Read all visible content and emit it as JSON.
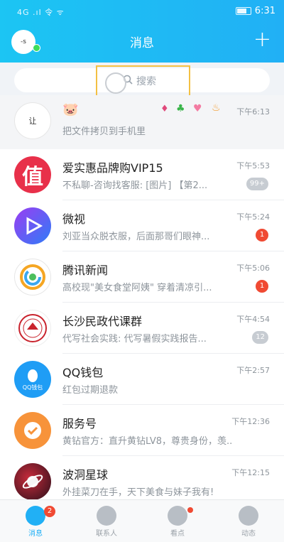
{
  "status_bar": {
    "left": "4G .ıl 令 ᯤ",
    "time": "6:31",
    "battery": "70"
  },
  "header": {
    "title": "消息",
    "avatar_text": "-s"
  },
  "search": {
    "placeholder": "搜索"
  },
  "conversations": [
    {
      "name": "",
      "avatar_text": "让",
      "time": "下午6:13",
      "message": "把文件拷贝到手机里",
      "badge": "",
      "extra_icons": [
        "pig-emoji",
        "sparkle",
        "clover",
        "heart",
        "flame"
      ]
    },
    {
      "name": "爱实惠品牌购VIP15",
      "avatar_text": "值",
      "time": "下午5:53",
      "message": "不私聊-咨询找客服: [图片] 【第2...",
      "badge": "99+",
      "badge_grey": true
    },
    {
      "name": "微视",
      "avatar_text": "",
      "time": "下午5:24",
      "message": "刘亚当众脱衣服，后面那哥们眼神...",
      "badge": "1"
    },
    {
      "name": "腾讯新闻",
      "avatar_text": "",
      "time": "下午5:06",
      "message": "高校现\"美女食堂阿姨\" 穿着清凉引...",
      "badge": "1"
    },
    {
      "name": "长沙民政代课群",
      "avatar_text": "",
      "time": "下午4:54",
      "message": "代写社会实践: 代写暑假实践报告...",
      "badge": "12",
      "badge_grey": true
    },
    {
      "name": "QQ钱包",
      "avatar_text": "QQ钱包",
      "time": "下午2:57",
      "message": "红包过期退款",
      "badge": ""
    },
    {
      "name": "服务号",
      "avatar_text": "",
      "time": "下午12:36",
      "message": "黄钻官方：直升黄钻LV8，尊贵身份，羡...",
      "badge": ""
    },
    {
      "name": "波洞星球",
      "avatar_text": "",
      "time": "下午12:15",
      "message": "外挂菜刀在手，天下美食与妹子我有!",
      "badge": ""
    }
  ],
  "tabs": [
    {
      "label": "消息",
      "badge": "2"
    },
    {
      "label": "联系人"
    },
    {
      "label": "看点"
    },
    {
      "label": "动态"
    }
  ],
  "colors": {
    "accent": "#21b0f5",
    "badge": "#f04a33"
  }
}
